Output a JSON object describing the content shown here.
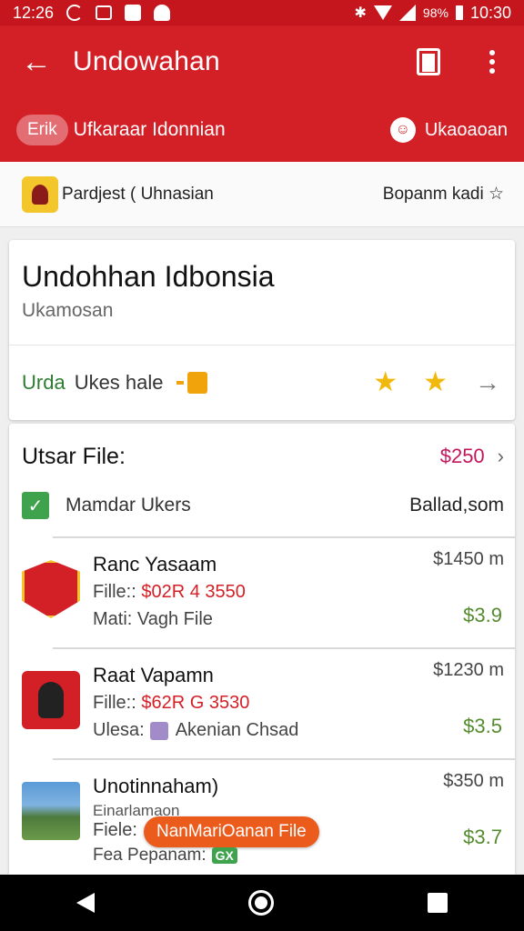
{
  "status_bar": {
    "time_left": "12:26",
    "battery": "98%",
    "time_right": "10:30"
  },
  "app_bar": {
    "title": "Undowahan"
  },
  "sub_bar": {
    "chip": "Erik",
    "text": "Ufkaraar Idonnian",
    "right_label": "Ukaoaoan"
  },
  "info_bar": {
    "left_text": "Pardjest ( Uhnasian",
    "right_text": "Bopanm kadi ☆"
  },
  "summary_card": {
    "title": "Undohhan Idbonsia",
    "subtitle": "Ukamosan",
    "green_label": "Urda",
    "label": "Ukes hale"
  },
  "files_section": {
    "title": "Utsar File:",
    "price": "$250",
    "checkbox_row": {
      "label": "Mamdar Ukers",
      "right": "Ballad,som"
    },
    "items": [
      {
        "title": "Ranc Yasaam",
        "price": "$1450 m",
        "line2_prefix": "Fille::",
        "line2_value": "$02R 4 3550",
        "line3": "Mati: Vagh File",
        "amount": "$3.9"
      },
      {
        "title": "Raat Vapamn",
        "price": "$1230 m",
        "line2_prefix": "Fille::",
        "line2_value": "$62R G 3530",
        "line3_prefix": "Ulesa:",
        "line3_value": "Akenian Chsad",
        "amount": "$3.5"
      },
      {
        "title": "Unotinnaham)",
        "price": "$350 m",
        "line_small": "Einarlamaon",
        "line2_prefix": "Fiele:",
        "pill": "NanMariOanan File",
        "line3": "Fea Pepanam:",
        "badge": "GX",
        "amount": "$3.7"
      }
    ]
  }
}
